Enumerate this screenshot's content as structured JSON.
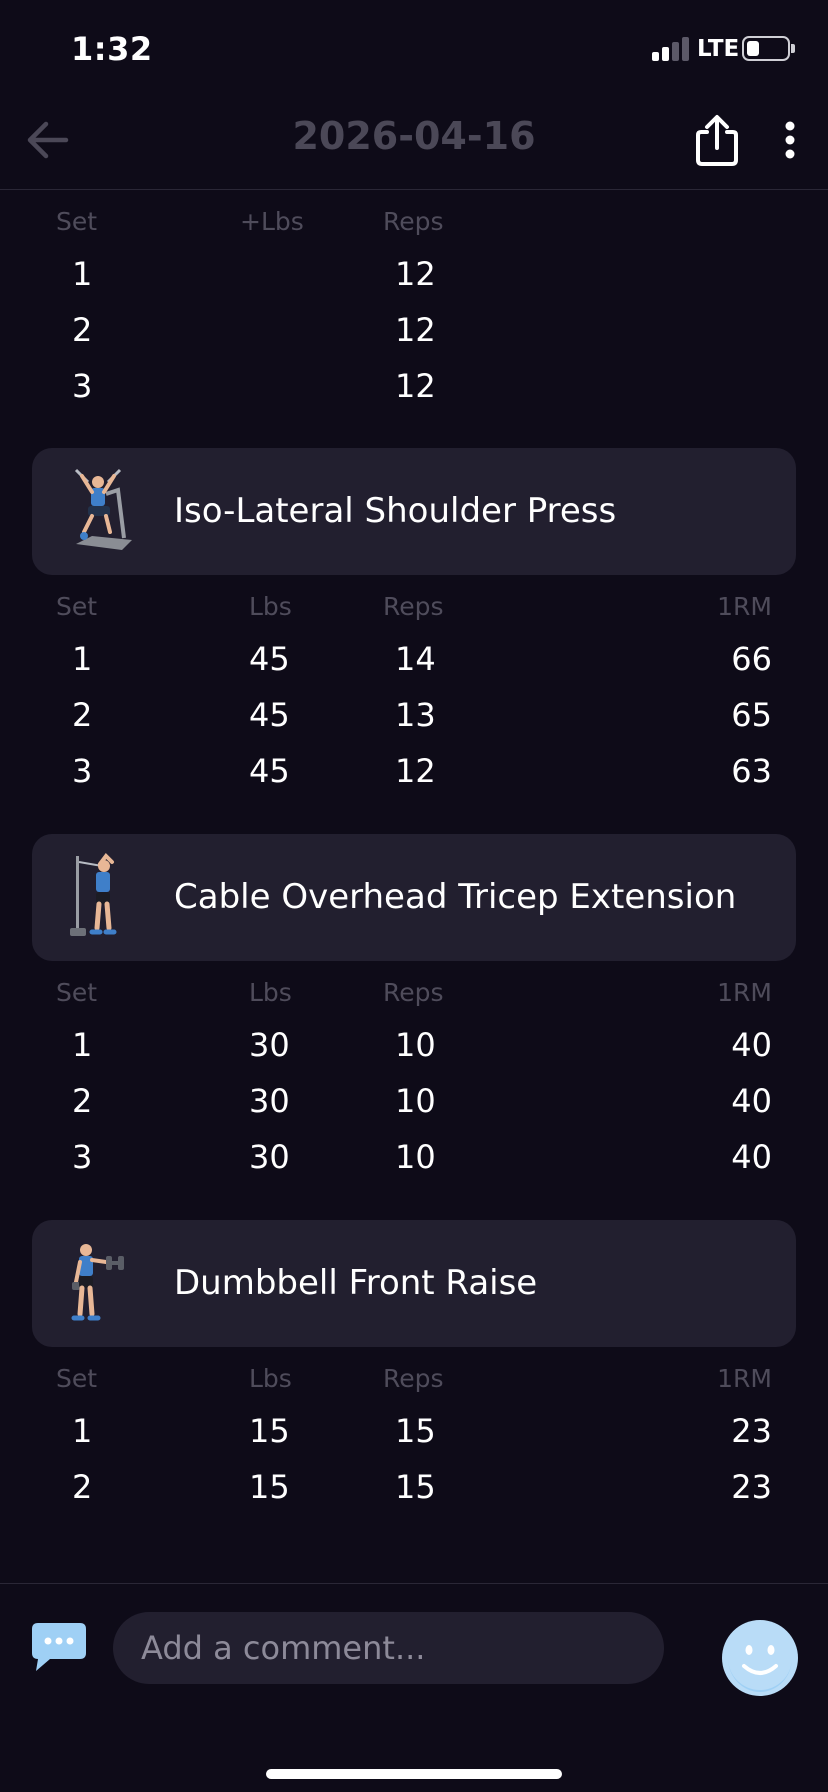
{
  "status_bar": {
    "time": "1:32",
    "network": "LTE"
  },
  "header": {
    "title": "2026-04-16"
  },
  "exercises": [
    {
      "name": "",
      "icon": "exercise-thumbnail",
      "columns": {
        "set": "Set",
        "weight": "+Lbs",
        "reps": "Reps",
        "one_rm": ""
      },
      "sets": [
        {
          "set": "1",
          "weight": "",
          "reps": "12",
          "one_rm": ""
        },
        {
          "set": "2",
          "weight": "",
          "reps": "12",
          "one_rm": ""
        },
        {
          "set": "3",
          "weight": "",
          "reps": "12",
          "one_rm": ""
        }
      ]
    },
    {
      "name": "Iso-Lateral Shoulder Press",
      "icon": "shoulder-press-machine-icon",
      "columns": {
        "set": "Set",
        "weight": "Lbs",
        "reps": "Reps",
        "one_rm": "1RM"
      },
      "sets": [
        {
          "set": "1",
          "weight": "45",
          "reps": "14",
          "one_rm": "66"
        },
        {
          "set": "2",
          "weight": "45",
          "reps": "13",
          "one_rm": "65"
        },
        {
          "set": "3",
          "weight": "45",
          "reps": "12",
          "one_rm": "63"
        }
      ]
    },
    {
      "name": "Cable Overhead Tricep Extension",
      "icon": "cable-tricep-extension-icon",
      "columns": {
        "set": "Set",
        "weight": "Lbs",
        "reps": "Reps",
        "one_rm": "1RM"
      },
      "sets": [
        {
          "set": "1",
          "weight": "30",
          "reps": "10",
          "one_rm": "40"
        },
        {
          "set": "2",
          "weight": "30",
          "reps": "10",
          "one_rm": "40"
        },
        {
          "set": "3",
          "weight": "30",
          "reps": "10",
          "one_rm": "40"
        }
      ]
    },
    {
      "name": "Dumbbell Front Raise",
      "icon": "dumbbell-front-raise-icon",
      "columns": {
        "set": "Set",
        "weight": "Lbs",
        "reps": "Reps",
        "one_rm": "1RM"
      },
      "sets": [
        {
          "set": "1",
          "weight": "15",
          "reps": "15",
          "one_rm": "23"
        },
        {
          "set": "2",
          "weight": "15",
          "reps": "15",
          "one_rm": "23"
        }
      ]
    }
  ],
  "comment": {
    "placeholder": "Add a comment..."
  },
  "colors": {
    "background": "#0e0b18",
    "card": "#221f2f",
    "muted_text": "#4f4c5b",
    "accent_blue": "#9fd0f5"
  }
}
